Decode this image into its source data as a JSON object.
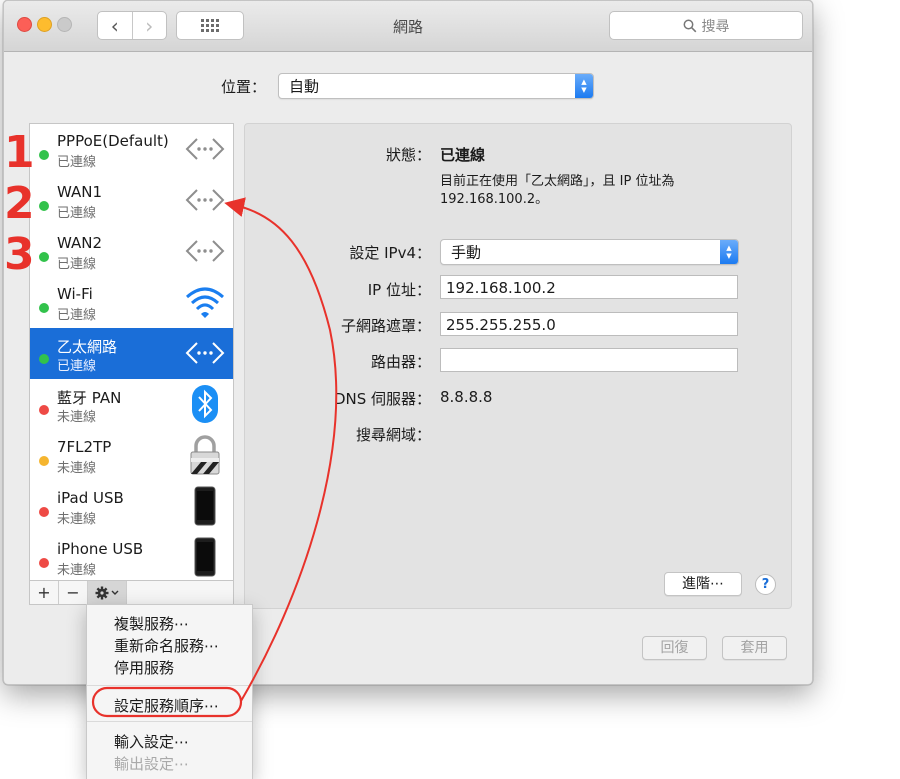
{
  "window": {
    "title": "網路",
    "search_placeholder": "搜尋"
  },
  "location": {
    "label": "位置：",
    "value": "自動"
  },
  "services": [
    {
      "name": "PPPoE(Default)",
      "status": "已連線",
      "dot": "green",
      "icon": "ethernet-icon"
    },
    {
      "name": "WAN1",
      "status": "已連線",
      "dot": "green",
      "icon": "ethernet-icon"
    },
    {
      "name": "WAN2",
      "status": "已連線",
      "dot": "green",
      "icon": "ethernet-icon"
    },
    {
      "name": "Wi-Fi",
      "status": "已連線",
      "dot": "green",
      "icon": "wifi-icon"
    },
    {
      "name": "乙太網路",
      "status": "已連線",
      "dot": "green",
      "icon": "ethernet-icon",
      "selected": true
    },
    {
      "name": "藍牙 PAN",
      "status": "未連線",
      "dot": "red",
      "icon": "bluetooth-icon"
    },
    {
      "name": "7FL2TP",
      "status": "未連線",
      "dot": "amber",
      "icon": "lock-icon"
    },
    {
      "name": "iPad USB",
      "status": "未連線",
      "dot": "red",
      "icon": "device-icon"
    },
    {
      "name": "iPhone USB",
      "status": "未連線",
      "dot": "red",
      "icon": "device-icon"
    }
  ],
  "toolbar": {
    "add": "+",
    "remove": "−"
  },
  "detail": {
    "status_label": "狀態：",
    "status_value": "已連線",
    "status_desc1": "目前正在使用「乙太網路」，且 IP 位址為",
    "status_desc2": "192.168.100.2。",
    "ipv4_label": "設定 IPv4：",
    "ipv4_value": "手動",
    "ip_label": "IP 位址：",
    "ip_value": "192.168.100.2",
    "subnet_label": "子網路遮罩：",
    "subnet_value": "255.255.255.0",
    "router_label": "路由器：",
    "router_value": "",
    "dns_label": "DNS 伺服器：",
    "dns_value": "8.8.8.8",
    "search_domain_label": "搜尋網域：",
    "advanced_button": "進階⋯",
    "help": "?",
    "revert_button": "回復",
    "apply_button": "套用"
  },
  "menu": {
    "items": [
      "複製服務⋯",
      "重新命名服務⋯",
      "停用服務",
      "設定服務順序⋯",
      "輸入設定⋯",
      "輸出設定⋯"
    ]
  },
  "annotations": {
    "labels": [
      "1",
      "2",
      "3"
    ],
    "color": "#e8322b"
  },
  "colors": {
    "selected": "#1a6ed8",
    "connected": "#32c24b",
    "disconnected": "#ee4a45",
    "pending": "#f5b52f"
  }
}
